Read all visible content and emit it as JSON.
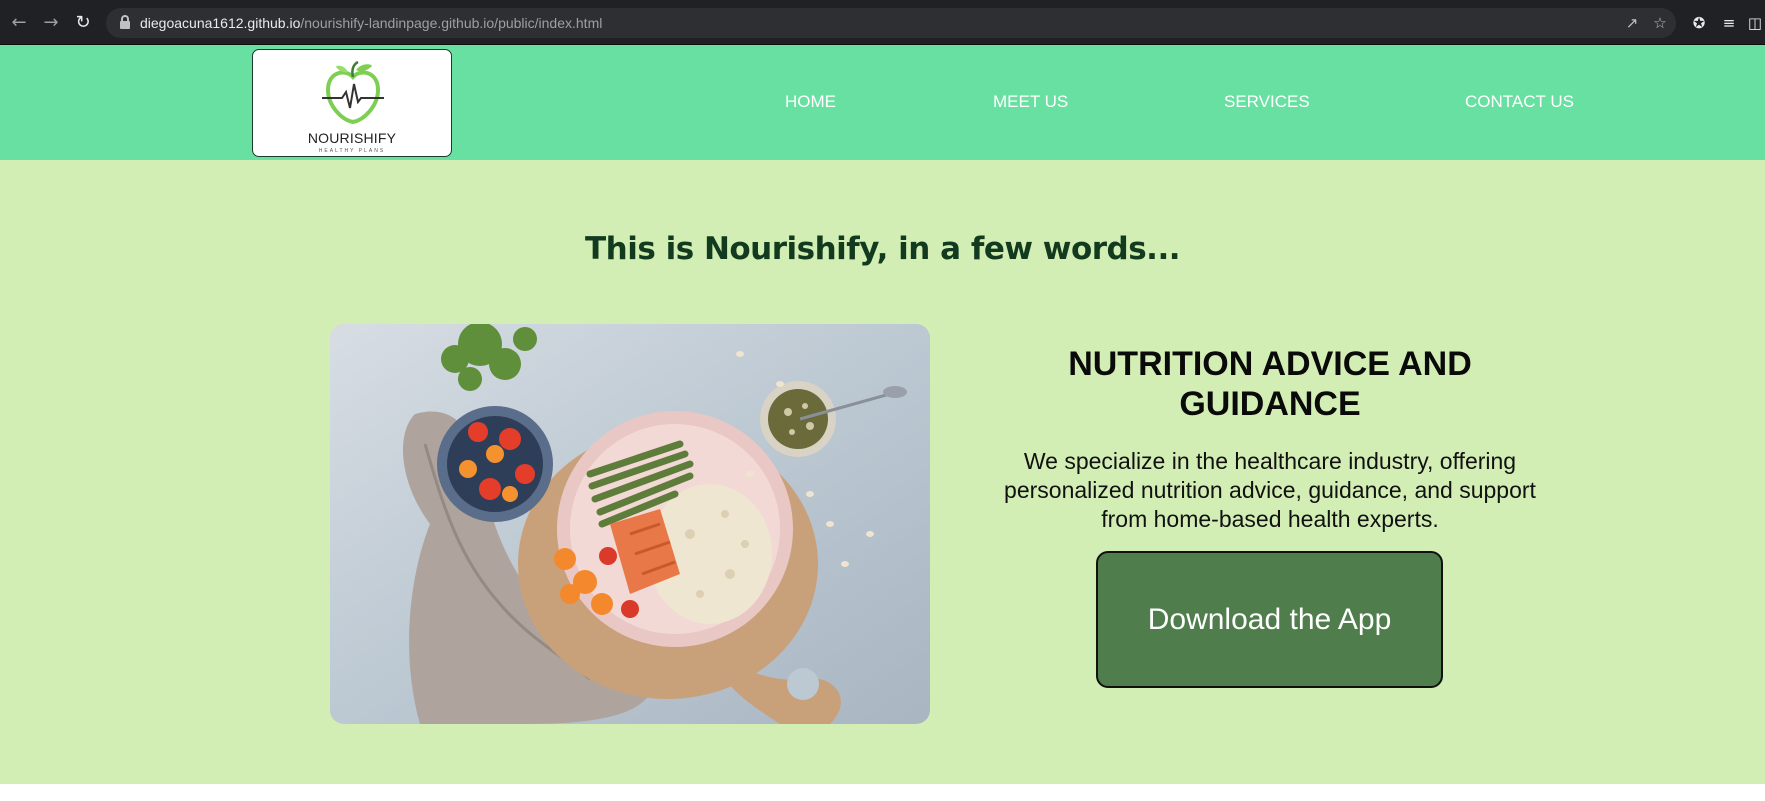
{
  "browser": {
    "url_host": "diegoacuna1612.github.io",
    "url_path": "/nourishify-landinpage.github.io/public/index.html",
    "icons": [
      "back-arrow-icon",
      "forward-arrow-icon",
      "reload-icon",
      "lock-icon",
      "share-icon",
      "star-icon",
      "puzzle-icon",
      "reading-list-icon",
      "side-panel-icon"
    ]
  },
  "header": {
    "logo": {
      "name": "NOURISHIFY",
      "tagline": "HEALTHY PLANS"
    },
    "nav": [
      {
        "label": "HOME"
      },
      {
        "label": "MEET US"
      },
      {
        "label": "SERVICES"
      },
      {
        "label": "CONTACT US"
      }
    ],
    "background_color": "#68e0a2"
  },
  "main": {
    "title": "This is Nourishify, in a few words...",
    "feature": {
      "title": "NUTRITION ADVICE AND GUIDANCE",
      "text": "We specialize in the healthcare industry, offering personalized nutrition advice, guidance, and support from home-based health experts."
    },
    "cta_label": "Download the App",
    "background_color": "#d3eeb4",
    "button_color": "#4f7d4c"
  }
}
